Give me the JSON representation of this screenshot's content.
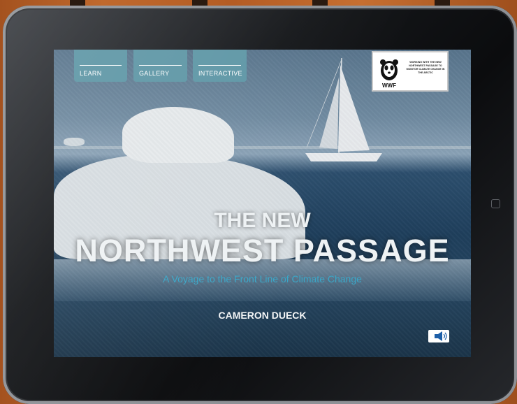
{
  "nav": {
    "tabs": [
      {
        "label": "LEARN"
      },
      {
        "label": "GALLERY"
      },
      {
        "label": "INTERACTIVE"
      }
    ]
  },
  "wwf": {
    "logo_text": "WWF",
    "description": "Working with the new Northwest Passage to monitor climate change in the Arctic"
  },
  "cover": {
    "title_line1": "THE NEW",
    "title_line2": "NORTHWEST PASSAGE",
    "subtitle": "A Voyage to the Front Line of Climate Change",
    "author": "CAMERON DUECK"
  },
  "icons": {
    "sound": "speaker-icon",
    "home": "home-button-icon"
  },
  "colors": {
    "tab_bg": "#5f97a6",
    "subtitle": "#3aa7c8",
    "background_wood": "#b45c24"
  }
}
